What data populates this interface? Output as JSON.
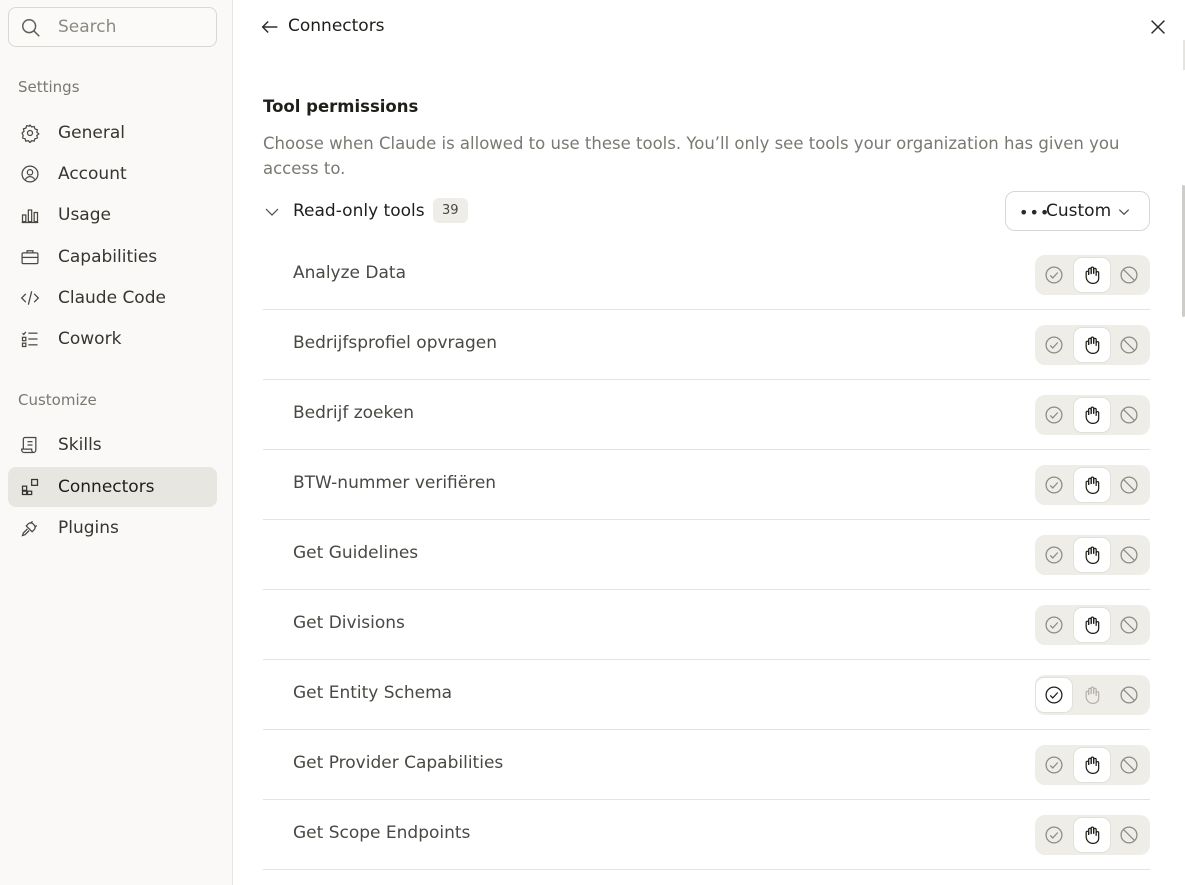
{
  "search": {
    "placeholder": "Search"
  },
  "sidebar": {
    "settings_label": "Settings",
    "customize_label": "Customize",
    "settings_items": [
      {
        "label": "General",
        "icon": "gear-icon"
      },
      {
        "label": "Account",
        "icon": "user-circle-icon"
      },
      {
        "label": "Usage",
        "icon": "bar-chart-icon"
      },
      {
        "label": "Capabilities",
        "icon": "briefcase-icon"
      },
      {
        "label": "Claude Code",
        "icon": "code-icon"
      },
      {
        "label": "Cowork",
        "icon": "checklist-icon"
      }
    ],
    "customize_items": [
      {
        "label": "Skills",
        "icon": "scroll-icon"
      },
      {
        "label": "Connectors",
        "icon": "blocks-icon",
        "active": true
      },
      {
        "label": "Plugins",
        "icon": "plug-icon"
      }
    ]
  },
  "header": {
    "title": "Connectors"
  },
  "permissions": {
    "title": "Tool permissions",
    "description": "Choose when Claude is allowed to use these tools. You’ll only see tools your organization has given you access to.",
    "group": {
      "name": "Read-only tools",
      "count": "39",
      "mode": "Custom"
    },
    "tools": [
      {
        "name": "Analyze Data",
        "setting": "ask"
      },
      {
        "name": "Bedrijfsprofiel opvragen",
        "setting": "ask"
      },
      {
        "name": "Bedrijf zoeken",
        "setting": "ask"
      },
      {
        "name": "BTW-nummer verifiëren",
        "setting": "ask"
      },
      {
        "name": "Get Guidelines",
        "setting": "ask"
      },
      {
        "name": "Get Divisions",
        "setting": "ask"
      },
      {
        "name": "Get Entity Schema",
        "setting": "allow"
      },
      {
        "name": "Get Provider Capabilities",
        "setting": "ask"
      },
      {
        "name": "Get Scope Endpoints",
        "setting": "ask"
      }
    ]
  },
  "colors": {
    "active_bg": "#e8e6e1",
    "segment_bg": "#efede8",
    "muted_text": "#7b7872"
  }
}
